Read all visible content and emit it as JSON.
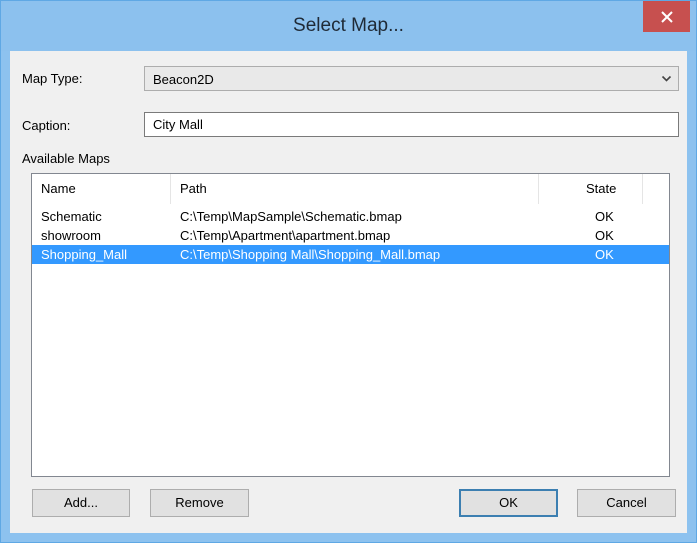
{
  "window": {
    "title": "Select Map...",
    "close_symbol": "×"
  },
  "form": {
    "map_type_label": "Map Type:",
    "map_type_value": "Beacon2D",
    "caption_label": "Caption:",
    "caption_value": "City Mall",
    "available_maps_label": "Available Maps"
  },
  "table": {
    "columns": [
      "Name",
      "Path",
      "State"
    ],
    "rows": [
      {
        "name": "Schematic",
        "path": "C:\\Temp\\MapSample\\Schematic.bmap",
        "state": "OK",
        "selected": false
      },
      {
        "name": "showroom",
        "path": "C:\\Temp\\Apartment\\apartment.bmap",
        "state": "OK",
        "selected": false
      },
      {
        "name": "Shopping_Mall",
        "path": "C:\\Temp\\Shopping Mall\\Shopping_Mall.bmap",
        "state": "OK",
        "selected": true
      }
    ]
  },
  "buttons": {
    "add": "Add...",
    "remove": "Remove",
    "ok": "OK",
    "cancel": "Cancel"
  },
  "colors": {
    "titlebar": "#8cc1ee",
    "close": "#c7504f",
    "selection": "#3399ff"
  },
  "icons": {
    "close": "close-icon",
    "dropdown": "chevron-down-icon"
  }
}
